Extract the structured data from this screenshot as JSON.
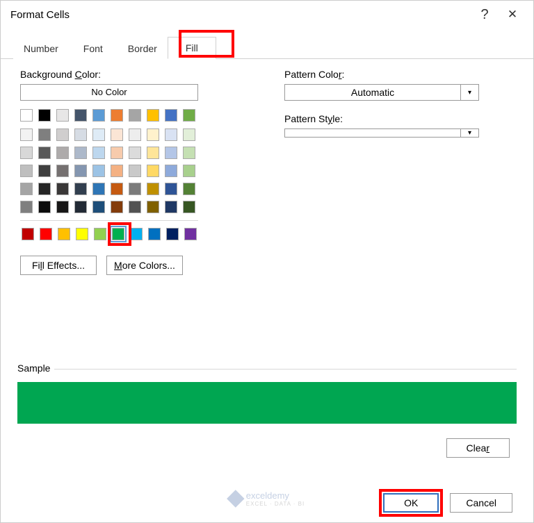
{
  "title": "Format Cells",
  "titlebar": {
    "help": "?",
    "close": "✕"
  },
  "tabs": {
    "number": "Number",
    "font": "Font",
    "border": "Border",
    "fill": "Fill",
    "active": "Fill"
  },
  "bg": {
    "label_pre": "Background ",
    "label_u": "C",
    "label_post": "olor:",
    "no_color": "No Color",
    "row1": [
      "#ffffff",
      "#000000",
      "#e7e6e6",
      "#44546a",
      "#5b9bd5",
      "#ed7d31",
      "#a5a5a5",
      "#ffc000",
      "#4472c4",
      "#70ad47"
    ],
    "theme_rows": [
      [
        "#f2f2f2",
        "#7f7f7f",
        "#d0cece",
        "#d6dce4",
        "#deebf6",
        "#fbe5d5",
        "#ededed",
        "#fff2cc",
        "#d9e2f3",
        "#e2efd9"
      ],
      [
        "#d8d8d8",
        "#595959",
        "#aeabab",
        "#adb9ca",
        "#bdd7ee",
        "#f7cbac",
        "#dbdbdb",
        "#fee599",
        "#b4c6e7",
        "#c5e0b3"
      ],
      [
        "#bfbfbf",
        "#3f3f3f",
        "#757070",
        "#8496b0",
        "#9cc3e5",
        "#f4b183",
        "#c9c9c9",
        "#ffd965",
        "#8eaadb",
        "#a8d08d"
      ],
      [
        "#a5a5a5",
        "#262626",
        "#3a3838",
        "#323f4f",
        "#2e75b5",
        "#c55a11",
        "#7b7b7b",
        "#bf9000",
        "#2f5496",
        "#538135"
      ],
      [
        "#7f7f7f",
        "#0c0c0c",
        "#171616",
        "#222a35",
        "#1e4e79",
        "#833c0b",
        "#525252",
        "#7f6000",
        "#1f3864",
        "#375623"
      ]
    ],
    "standard": [
      "#c00000",
      "#ff0000",
      "#ffc000",
      "#ffff00",
      "#92d050",
      "#00b050",
      "#00b0f0",
      "#0070c0",
      "#002060",
      "#7030a0"
    ],
    "selected_index": 5
  },
  "buttons": {
    "fill_pre": "Fi",
    "fill_u": "l",
    "fill_post": "l Effects...",
    "more_u": "M",
    "more_post": "ore Colors..."
  },
  "pattern": {
    "color_label": "Pattern Color:",
    "color_u": "A",
    "color_val": "Automatic",
    "style_label_pre": "Pattern St",
    "style_u": "y",
    "style_label_post": "le:",
    "style_val": ""
  },
  "sample": {
    "label": "Sample",
    "color": "#00a651"
  },
  "footer": {
    "clear_pre": "Clea",
    "clear_u": "r",
    "ok": "OK",
    "cancel": "Cancel"
  },
  "watermark": {
    "name": "exceldemy",
    "sub": "EXCEL · DATA · BI"
  }
}
